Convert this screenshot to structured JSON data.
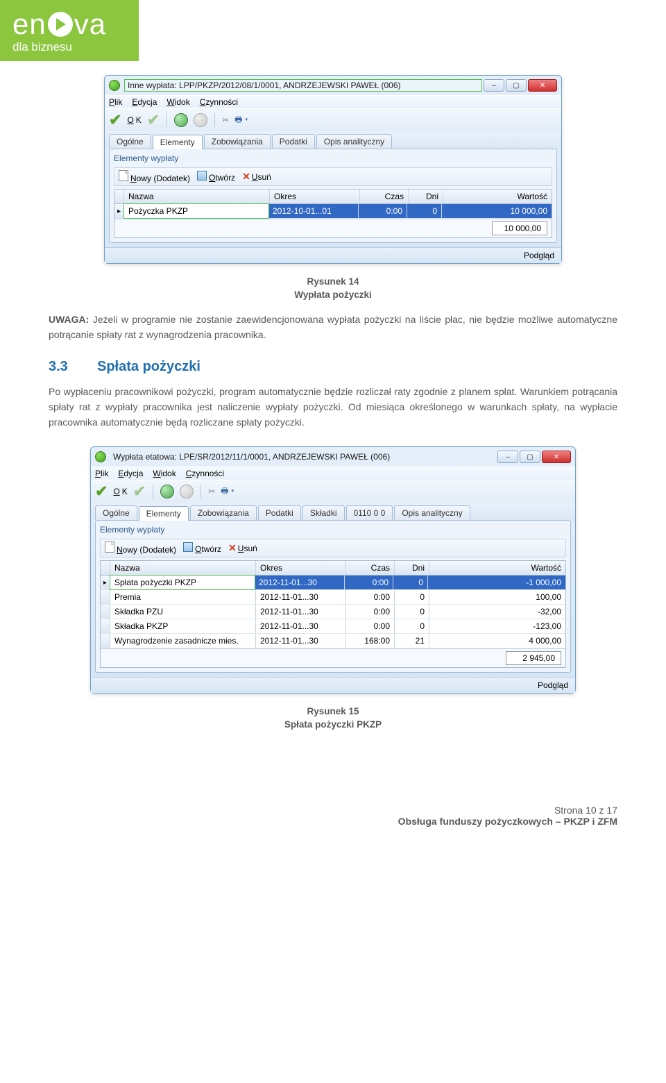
{
  "logo": {
    "brand_a": "en",
    "brand_b": "va",
    "tagline": "dla biznesu"
  },
  "win1": {
    "title": "Inne wypłata: LPP/PKZP/2012/08/1/0001, ANDRZEJEWSKI PAWEŁ (006)",
    "menu": {
      "plik": "Plik",
      "edycja": "Edycja",
      "widok": "Widok",
      "czynnosci": "Czynności"
    },
    "ok_label": "OK",
    "tabs": {
      "ogolne": "Ogólne",
      "elementy": "Elementy",
      "zobowiazania": "Zobowiązania",
      "podatki": "Podatki",
      "opis": "Opis analityczny"
    },
    "group_title": "Elementy wypłaty",
    "subtoolbar": {
      "nowy": "Nowy (Dodatek)",
      "otworz": "Otwórz",
      "usun": "Usuń"
    },
    "columns": {
      "nazwa": "Nazwa",
      "okres": "Okres",
      "czas": "Czas",
      "dni": "Dni",
      "wartosc": "Wartość"
    },
    "row": {
      "nazwa": "Pożyczka PKZP",
      "okres": "2012-10-01...01",
      "czas": "0:00",
      "dni": "0",
      "wartosc": "10 000,00"
    },
    "total": "10 000,00",
    "status": "Podgląd"
  },
  "fig14": {
    "caption": "Rysunek 14",
    "sub": "Wypłata pożyczki"
  },
  "para1_bold": "UWAGA:",
  "para1_rest": " Jeżeli w programie nie zostanie zaewidencjonowana wypłata pożyczki na liście płac, nie będzie możliwe automatyczne potrącanie spłaty rat z wynagrodzenia pracownika.",
  "section": {
    "num": "3.3",
    "title": "Spłata pożyczki"
  },
  "para2": "Po wypłaceniu pracownikowi pożyczki, program automatycznie będzie rozliczał raty zgodnie z planem spłat. Warunkiem potrącania spłaty rat z wypłaty pracownika jest naliczenie wypłaty pożyczki. Od miesiąca określonego w warunkach spłaty, na wypłacie pracownika automatycznie będą rozliczane spłaty pożyczki.",
  "win2": {
    "title": "Wypłata etatowa: LPE/SR/2012/11/1/0001, ANDRZEJEWSKI PAWEŁ (006)",
    "menu": {
      "plik": "Plik",
      "edycja": "Edycja",
      "widok": "Widok",
      "czynnosci": "Czynności"
    },
    "ok_label": "OK",
    "tabs": {
      "ogolne": "Ogólne",
      "elementy": "Elementy",
      "zobowiazania": "Zobowiązania",
      "podatki": "Podatki",
      "skladki": "Składki",
      "zero": "0110 0 0",
      "opis": "Opis analityczny"
    },
    "group_title": "Elementy wypłaty",
    "subtoolbar": {
      "nowy": "Nowy (Dodatek)",
      "otworz": "Otwórz",
      "usun": "Usuń"
    },
    "columns": {
      "nazwa": "Nazwa",
      "okres": "Okres",
      "czas": "Czas",
      "dni": "Dni",
      "wartosc": "Wartość"
    },
    "rows": [
      {
        "nazwa": "Spłata pożyczki PKZP",
        "okres": "2012-11-01...30",
        "czas": "0:00",
        "dni": "0",
        "wartosc": "-1 000,00"
      },
      {
        "nazwa": "Premia",
        "okres": "2012-11-01...30",
        "czas": "0:00",
        "dni": "0",
        "wartosc": "100,00"
      },
      {
        "nazwa": "Składka PZU",
        "okres": "2012-11-01...30",
        "czas": "0:00",
        "dni": "0",
        "wartosc": "-32,00"
      },
      {
        "nazwa": "Składka PKZP",
        "okres": "2012-11-01...30",
        "czas": "0:00",
        "dni": "0",
        "wartosc": "-123,00"
      },
      {
        "nazwa": "Wynagrodzenie zasadnicze mies.",
        "okres": "2012-11-01...30",
        "czas": "168:00",
        "dni": "21",
        "wartosc": "4 000,00"
      }
    ],
    "total": "2 945,00",
    "status": "Podgląd"
  },
  "fig15": {
    "caption": "Rysunek 15",
    "sub": "Spłata pożyczki PKZP"
  },
  "footer": {
    "page": "Strona 10 z 17",
    "doc": "Obsługa funduszy pożyczkowych – PKZP i ZFM"
  }
}
